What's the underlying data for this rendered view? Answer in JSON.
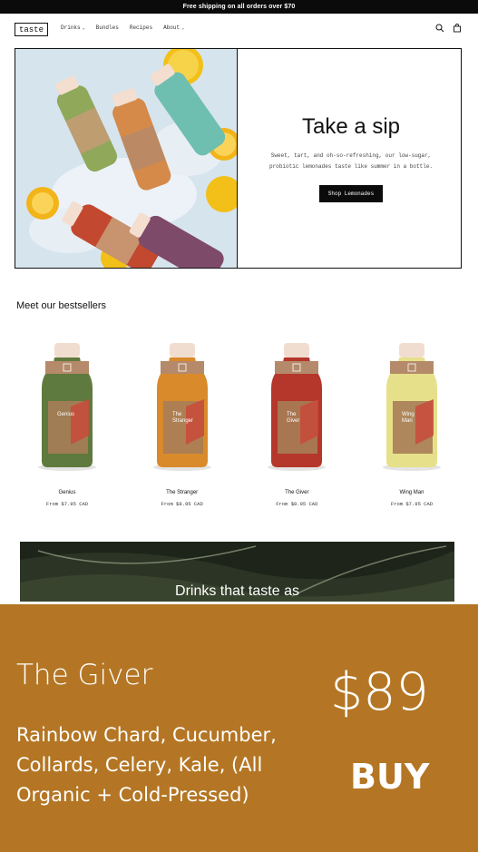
{
  "announcement": "Free shipping on all orders over $70",
  "header": {
    "logo": "taste",
    "nav": [
      {
        "label": "Drinks",
        "has_caret": true
      },
      {
        "label": "Bundles",
        "has_caret": false
      },
      {
        "label": "Recipes",
        "has_caret": false
      },
      {
        "label": "About",
        "has_caret": true
      }
    ],
    "icons": [
      "search-icon",
      "cart-icon"
    ]
  },
  "hero": {
    "title": "Take a sip",
    "subtitle": "Sweet, tart, and oh-so-refreshing, our low-sugar, probiotic lemonades taste like summer in a bottle.",
    "button": "Shop Lemonades"
  },
  "bestsellers": {
    "title": "Meet our bestsellers",
    "products": [
      {
        "name": "Genius",
        "price": "From $7.95 CAD",
        "color": "#5f7a3e",
        "label": "Genius"
      },
      {
        "name": "The Stranger",
        "price": "From $8.95 CAD",
        "color": "#d98a2b",
        "label": "The Stranger"
      },
      {
        "name": "The Giver",
        "price": "From $8.95 CAD",
        "color": "#b5362a",
        "label": "The Giver"
      },
      {
        "name": "Wing Man",
        "price": "From $7.95 CAD",
        "color": "#e6e08a",
        "label": "Wing Man"
      }
    ]
  },
  "banner": {
    "text": "Drinks that taste as"
  },
  "overlay": {
    "product_name": "The Giver",
    "description": "Rainbow Chard, Cucumber, Collards, Celery, Kale,  (All Organic + Cold-Pressed)",
    "price": "$89",
    "buy": "BUY",
    "background": "#b47624"
  }
}
